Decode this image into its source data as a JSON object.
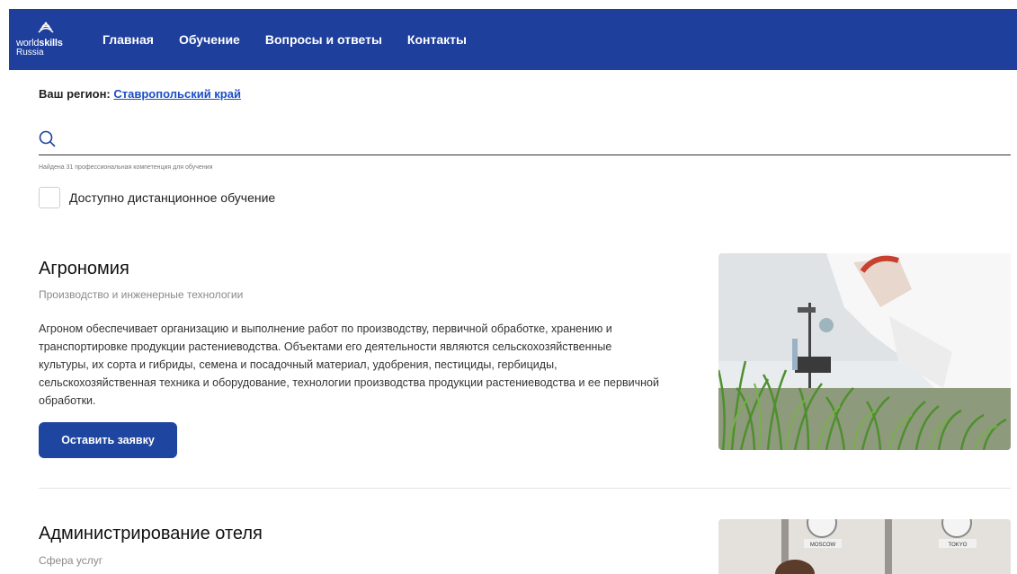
{
  "header": {
    "logo": {
      "line1_thin": "world",
      "line1_bold": "skills",
      "line2": "Russia"
    },
    "nav": [
      {
        "label": "Главная"
      },
      {
        "label": "Обучение"
      },
      {
        "label": "Вопросы и ответы"
      },
      {
        "label": "Контакты"
      }
    ],
    "colors": {
      "navbar": "#1e3f9b",
      "link": "#1a4fc4",
      "button": "#1e46a0"
    }
  },
  "region": {
    "label": "Ваш регион:",
    "value": "Ставропольский край"
  },
  "search": {
    "value": "",
    "placeholder": "",
    "icon": "search-icon"
  },
  "results": {
    "found_text": "Найдена 31 профессиональная компетенция для обучения"
  },
  "filters": {
    "distance_label": "Доступно дистанционное обучение",
    "distance_checked": false
  },
  "competencies": [
    {
      "title": "Агрономия",
      "category": "Производство и инженерные технологии",
      "description": "Агроном обеспечивает организацию и выполнение работ по производству, первичной обработке, хранению и транспортировке продукции растениеводства. Объектами его деятельности являются сельскохозяйственные культуры, их сорта и гибриды, семена и посадочный материал, удобрения, пестициды, гербициды, сельскохозяйственная техника и оборудование, технологии производства продукции растениеводства и ее первичной обработки.",
      "button_label": "Оставить заявку"
    },
    {
      "title": "Администрирование отеля",
      "category": "Сфера услуг",
      "photo_clock_labels": [
        "MOSCOW",
        "TOKYO"
      ]
    }
  ]
}
